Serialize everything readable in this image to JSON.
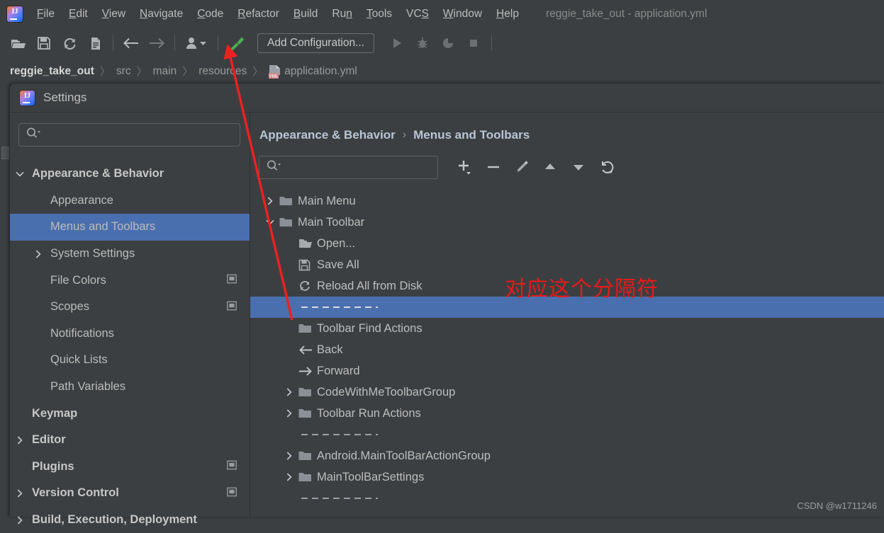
{
  "ide": {
    "menubar": {
      "items": [
        {
          "label": "File",
          "mnemonic": "F"
        },
        {
          "label": "Edit",
          "mnemonic": "E"
        },
        {
          "label": "View",
          "mnemonic": "V"
        },
        {
          "label": "Navigate",
          "mnemonic": "N"
        },
        {
          "label": "Code",
          "mnemonic": "C"
        },
        {
          "label": "Refactor",
          "mnemonic": "R"
        },
        {
          "label": "Build",
          "mnemonic": "B"
        },
        {
          "label": "Run",
          "mnemonic": "n"
        },
        {
          "label": "Tools",
          "mnemonic": "T"
        },
        {
          "label": "VCS",
          "mnemonic": "S"
        },
        {
          "label": "Window",
          "mnemonic": "W"
        },
        {
          "label": "Help",
          "mnemonic": "H"
        }
      ],
      "window_title": "reggie_take_out - application.yml",
      "app_logo": "intellij-idea-logo"
    },
    "toolbar": {
      "icons": [
        "open-folder-icon",
        "save-all-icon",
        "reload-from-disk-icon",
        "copy-icon",
        "back-arrow-icon",
        "forward-arrow-icon",
        "user-account-icon",
        "build-hammer-icon"
      ],
      "add_configuration_label": "Add Configuration...",
      "run_icons": [
        "run-icon",
        "debug-icon",
        "run-coverage-icon",
        "stop-icon"
      ]
    },
    "breadcrumb": {
      "items": [
        {
          "label": "reggie_take_out",
          "bold": true,
          "icon": ""
        },
        {
          "label": "src",
          "bold": false,
          "icon": ""
        },
        {
          "label": "main",
          "bold": false,
          "icon": ""
        },
        {
          "label": "resources",
          "bold": false,
          "icon": ""
        },
        {
          "label": "application.yml",
          "bold": false,
          "icon": "yml-file-icon"
        }
      ],
      "separator": "〉"
    }
  },
  "dialog": {
    "title": "Settings",
    "logo": "intellij-idea-logo",
    "sidebar": {
      "search_placeholder": "",
      "search_value": "",
      "items": [
        {
          "label": "Appearance & Behavior",
          "indent": 0,
          "twisty": "down",
          "bold": true,
          "selected": false,
          "external": false
        },
        {
          "label": "Appearance",
          "indent": 1,
          "twisty": "none",
          "bold": false,
          "selected": false,
          "external": false
        },
        {
          "label": "Menus and Toolbars",
          "indent": 1,
          "twisty": "none",
          "bold": false,
          "selected": true,
          "external": false
        },
        {
          "label": "System Settings",
          "indent": 1,
          "twisty": "right",
          "bold": false,
          "selected": false,
          "external": false
        },
        {
          "label": "File Colors",
          "indent": 1,
          "twisty": "none",
          "bold": false,
          "selected": false,
          "external": true
        },
        {
          "label": "Scopes",
          "indent": 1,
          "twisty": "none",
          "bold": false,
          "selected": false,
          "external": true
        },
        {
          "label": "Notifications",
          "indent": 1,
          "twisty": "none",
          "bold": false,
          "selected": false,
          "external": false
        },
        {
          "label": "Quick Lists",
          "indent": 1,
          "twisty": "none",
          "bold": false,
          "selected": false,
          "external": false
        },
        {
          "label": "Path Variables",
          "indent": 1,
          "twisty": "none",
          "bold": false,
          "selected": false,
          "external": false
        },
        {
          "label": "Keymap",
          "indent": 0,
          "twisty": "none",
          "bold": true,
          "selected": false,
          "external": false
        },
        {
          "label": "Editor",
          "indent": 0,
          "twisty": "right",
          "bold": true,
          "selected": false,
          "external": false
        },
        {
          "label": "Plugins",
          "indent": 0,
          "twisty": "none",
          "bold": true,
          "selected": false,
          "external": true
        },
        {
          "label": "Version Control",
          "indent": 0,
          "twisty": "right",
          "bold": true,
          "selected": false,
          "external": true
        },
        {
          "label": "Build, Execution, Deployment",
          "indent": 0,
          "twisty": "right",
          "bold": true,
          "selected": false,
          "external": false
        }
      ]
    },
    "main": {
      "breadcrumb": {
        "parent": "Appearance & Behavior",
        "separator": "›",
        "current": "Menus and Toolbars"
      },
      "search_placeholder": "",
      "search_value": "",
      "buttons": [
        {
          "name": "add-button",
          "glyph": "+"
        },
        {
          "name": "remove-button",
          "glyph": "−"
        },
        {
          "name": "edit-button",
          "glyph": "pencil"
        },
        {
          "name": "move-up-button",
          "glyph": "▲"
        },
        {
          "name": "move-down-button",
          "glyph": "▼"
        },
        {
          "name": "restore-button",
          "glyph": "restore"
        }
      ],
      "tree": [
        {
          "label": "Main Menu",
          "indent": 0,
          "twisty": "right",
          "icon": "folder-icon",
          "selected": false,
          "separator": false
        },
        {
          "label": "Main Toolbar",
          "indent": 0,
          "twisty": "down",
          "icon": "folder-icon",
          "selected": false,
          "separator": false
        },
        {
          "label": "Open...",
          "indent": 1,
          "twisty": "none",
          "icon": "open-folder-icon",
          "selected": false,
          "separator": false
        },
        {
          "label": "Save All",
          "indent": 1,
          "twisty": "none",
          "icon": "save-all-icon",
          "selected": false,
          "separator": false
        },
        {
          "label": "Reload All from Disk",
          "indent": 1,
          "twisty": "none",
          "icon": "reload-icon",
          "selected": false,
          "separator": false
        },
        {
          "label": "",
          "indent": 1,
          "twisty": "none",
          "icon": "none",
          "selected": true,
          "separator": true
        },
        {
          "label": "Toolbar Find Actions",
          "indent": 1,
          "twisty": "none",
          "icon": "folder-icon",
          "selected": false,
          "separator": false
        },
        {
          "label": "Back",
          "indent": 1,
          "twisty": "none",
          "icon": "back-arrow-icon",
          "selected": false,
          "separator": false
        },
        {
          "label": "Forward",
          "indent": 1,
          "twisty": "none",
          "icon": "forward-arrow-icon",
          "selected": false,
          "separator": false
        },
        {
          "label": "CodeWithMeToolbarGroup",
          "indent": 1,
          "twisty": "right",
          "icon": "folder-icon",
          "selected": false,
          "separator": false
        },
        {
          "label": "Toolbar Run Actions",
          "indent": 1,
          "twisty": "right",
          "icon": "folder-icon",
          "selected": false,
          "separator": false
        },
        {
          "label": "",
          "indent": 1,
          "twisty": "none",
          "icon": "none",
          "selected": false,
          "separator": true
        },
        {
          "label": "Android.MainToolBarActionGroup",
          "indent": 1,
          "twisty": "right",
          "icon": "folder-icon",
          "selected": false,
          "separator": false
        },
        {
          "label": "MainToolBarSettings",
          "indent": 1,
          "twisty": "right",
          "icon": "folder-icon",
          "selected": false,
          "separator": false
        },
        {
          "label": "",
          "indent": 1,
          "twisty": "none",
          "icon": "none",
          "selected": false,
          "separator": true
        }
      ]
    }
  },
  "annotations": {
    "red_note": "对应这个分隔符",
    "arrow": "red-arrow",
    "watermark": "CSDN @w1711246"
  },
  "colors": {
    "window_bg": "#3c3f41",
    "selection_blue": "#4a6fae",
    "text": "#bbbbbb",
    "accent_red": "#e8191b",
    "breadcrumb_accent": "#b8c5d6"
  }
}
